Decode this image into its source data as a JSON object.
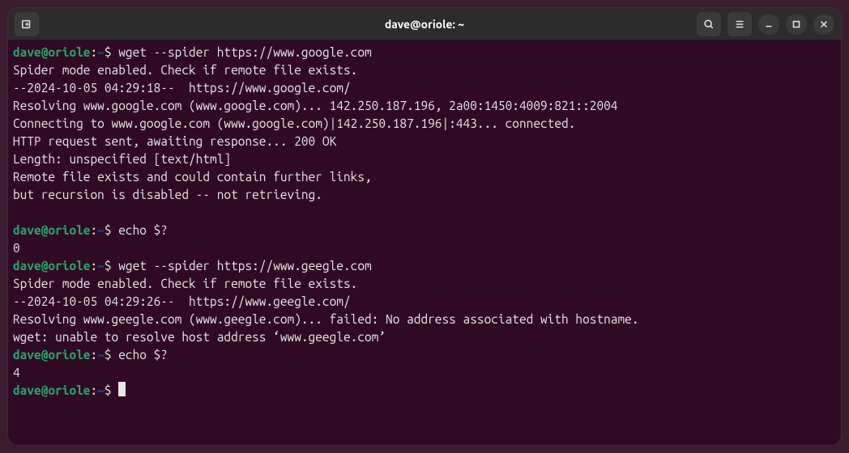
{
  "window": {
    "title": "dave@oriole: ~"
  },
  "prompt": {
    "user_host": "dave@oriole",
    "colon": ":",
    "path": "~",
    "dollar": "$"
  },
  "lines": {
    "cmd1": " wget --spider https://www.google.com",
    "out1": "Spider mode enabled. Check if remote file exists.",
    "out2": "--2024-10-05 04:29:18--  https://www.google.com/",
    "out3": "Resolving www.google.com (www.google.com)... 142.250.187.196, 2a00:1450:4009:821::2004",
    "out4": "Connecting to www.google.com (www.google.com)|142.250.187.196|:443... connected.",
    "out5": "HTTP request sent, awaiting response... 200 OK",
    "out6": "Length: unspecified [text/html]",
    "out7": "Remote file exists and could contain further links,",
    "out8": "but recursion is disabled -- not retrieving.",
    "blank": "",
    "cmd2": " echo $?",
    "out9": "0",
    "cmd3": " wget --spider https://www.geegle.com",
    "out10": "Spider mode enabled. Check if remote file exists.",
    "out11": "--2024-10-05 04:29:26--  https://www.geegle.com/",
    "out12": "Resolving www.geegle.com (www.geegle.com)... failed: No address associated with hostname.",
    "out13": "wget: unable to resolve host address ‘www.geegle.com’",
    "cmd4": " echo $?",
    "out14": "4",
    "cmd5": " "
  }
}
